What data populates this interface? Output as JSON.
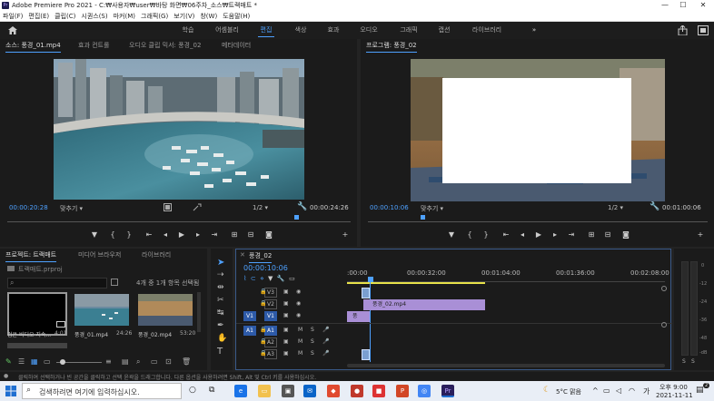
{
  "window": {
    "title": "Adobe Premiere Pro 2021 - C:₩사용자₩user₩바탕 화면₩06주차_소스₩트랙매트 *",
    "min_glyph": "—",
    "max_glyph": "☐",
    "close_glyph": "✕"
  },
  "menu": [
    "파일(F)",
    "편집(E)",
    "클립(C)",
    "시퀀스(S)",
    "마커(M)",
    "그래픽(G)",
    "보기(V)",
    "창(W)",
    "도움말(H)"
  ],
  "workspaces": [
    "학습",
    "어셈블리",
    "편집",
    "색상",
    "효과",
    "오디오",
    "그래픽",
    "캡션",
    "라이브러리"
  ],
  "workspace_more": "»",
  "source": {
    "tabs": [
      "소스: 풍경_01.mp4",
      "효과 컨트롤",
      "오디오 클립 믹서: 풍경_02",
      "메타데이터"
    ],
    "timecode_in": "00:00:20:28",
    "fit": "맞추기",
    "resolution": "1/2",
    "timecode_duration": "00:00:24:26"
  },
  "program": {
    "tab": "프로그램: 풍경_02",
    "timecode_in": "00:00:10:06",
    "fit": "맞추기",
    "resolution": "1/2",
    "timecode_duration": "00:01:00:06"
  },
  "project": {
    "tabs": [
      "프로젝트: 트랙매트",
      "미디어 브라우저",
      "라이브러리"
    ],
    "file": "트랙매트.prproj",
    "item_count": "4개 중 1개 항목 선택됨",
    "items": [
      {
        "name": "검은 비디오 지속...",
        "duration": "4:01"
      },
      {
        "name": "풍경_01.mp4",
        "duration": "24:26"
      },
      {
        "name": "풍경_02.mp4",
        "duration": "53:20"
      }
    ]
  },
  "timeline": {
    "tab": "풍경_02",
    "timecode": "00:00:10:06",
    "ruler": [
      ":00:00",
      "00:00:32:00",
      "00:01:04:00",
      "00:01:36:00",
      "00:02:08:00"
    ],
    "tracks": [
      {
        "src": "",
        "name": "V3",
        "kind": "video"
      },
      {
        "src": "",
        "name": "V2",
        "kind": "video"
      },
      {
        "src": "V1",
        "name": "V1",
        "kind": "video"
      },
      {
        "src": "A1",
        "name": "A1",
        "kind": "audio"
      },
      {
        "src": "",
        "name": "A2",
        "kind": "audio"
      },
      {
        "src": "",
        "name": "A3",
        "kind": "audio"
      }
    ],
    "clip_v2": "풍경_02.mp4",
    "clip_v1": "풍",
    "mute": "M",
    "solo": "S"
  },
  "meter": {
    "scale": [
      "0",
      "-12",
      "-24",
      "-36",
      "-48",
      "-dB"
    ],
    "labels": [
      "S",
      "S"
    ]
  },
  "status": "클릭하여 선택하거나 빈 공간을 클릭하고 선택 윤곽을 드래그합니다. 다른 옵션을 사용하려면 Shift, Alt 및 Ctrl 키를 사용하십시오.",
  "taskbar": {
    "search_placeholder": "검색하려면 여기에 입력하십시오.",
    "weather": "5°C 맑음",
    "ime": "가",
    "time": "오후 9:00",
    "date": "2021-11-11",
    "badge": "2"
  },
  "colors": {
    "accent": "#4ea1ff",
    "clip": "#a98fd6",
    "playhead": "#4ea1ff",
    "work_area": "#e8e24a",
    "premiere": "#2a1f5c"
  }
}
